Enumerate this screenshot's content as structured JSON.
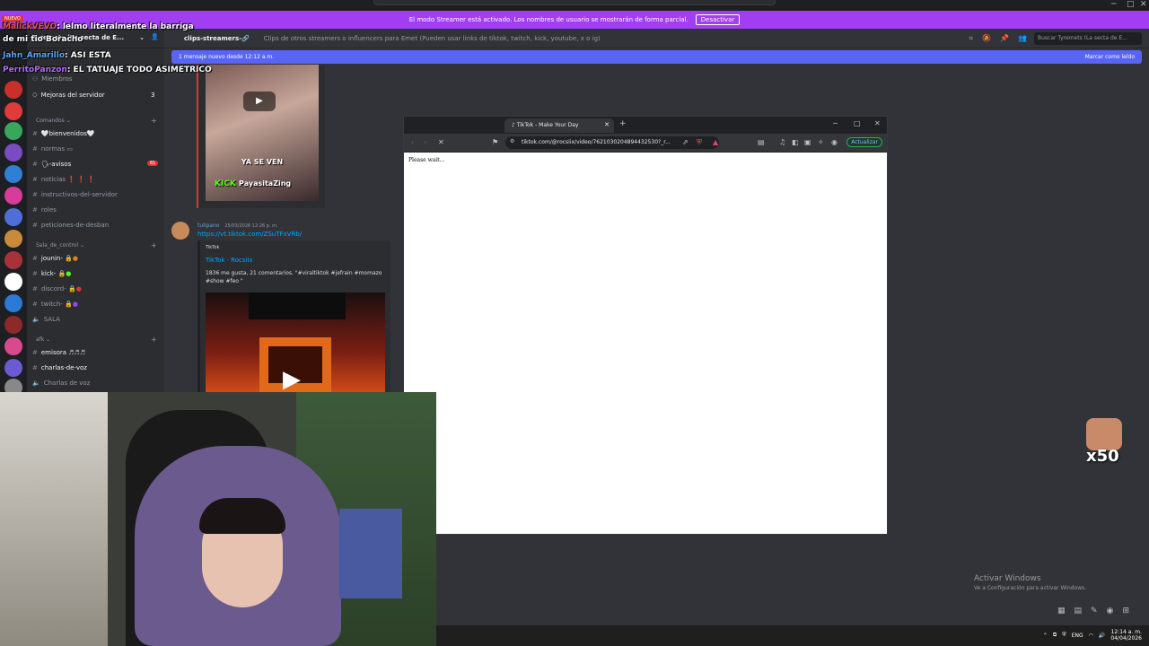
{
  "streamer_banner": {
    "text": "El modo Streamer está activado. Los nombres de usuario se mostrarán de forma parcial.",
    "button": "Desactivar",
    "badge_new": "NUEVO"
  },
  "server_name": "Tyremets (La secta de E...",
  "channels": {
    "members": "Miembros",
    "improvements": "Mejoras del servidor",
    "improvements_count": "3",
    "category_commands": "Comandos",
    "welcome": "🤍bienvenidos🤍",
    "rules": "normas",
    "notices": "🗣-avisos",
    "notices_count": "81",
    "news": "noticias",
    "news_marks": "❗ ❗ ❗",
    "server_instructions": "instructivos-del-servidor",
    "roles": "roles",
    "unban_requests": "peticiones-de-desban",
    "category_control": "Sala_de_control",
    "join": "jounin-",
    "kick": "kick-",
    "discord": "discord-",
    "twitch": "twitch-",
    "room": "SALA",
    "category_afk": "afk",
    "radio": "emisora",
    "voice_chats": "charlas-de-voz",
    "voice_chats_2": "Charlas de voz"
  },
  "chat_header": {
    "channel": "clips-streamers-🔗",
    "topic": "Clips de otros streamers o influencers para Emet (Pueden usar links de tiktok, twitch, kick, youtube, x o ig)",
    "search_placeholder": "Buscar Tyremets (La secta de E..."
  },
  "new_messages": {
    "text": "1 mensaje nuevo desde 12:12 a.m.",
    "mark_read": "Marcar como leído"
  },
  "message": {
    "author": "tulipano",
    "timestamp": "25/03/2026 12:26 p. m.",
    "link": "https://vt.tiktok.com/ZSuTFxVRb/",
    "embed_provider": "TikTok",
    "embed_title": "TikTok · Rocsiix",
    "embed_desc": "1836 me gusta, 21 comentarios. \"#viraltiktok #jefrain #momazo #show #feo \""
  },
  "video_thumb": {
    "caption": "YA SE VEN",
    "kick_label": "KICK",
    "kick_user": "PayasitaZing"
  },
  "overlay_chat": [
    {
      "user": "MalickVEVO",
      "text": ": lelmo literalmente la barriga"
    },
    {
      "user": "",
      "text": "de mi tio Boracho"
    },
    {
      "user": "Jahn_Amarillo",
      "text": ": ASI ESTA"
    },
    {
      "user": "PerritoPanzon",
      "text": ": EL TATUAJE TODO ASIMETRICO"
    }
  ],
  "browser": {
    "tab_title": "TikTok - Make Your Day",
    "url": "tiktok.com/@rocsiix/video/7621030204894432530?_r...",
    "update_button": "Actualizar",
    "content_text": "Please wait..."
  },
  "overlay_emote_count": "x50",
  "windows": {
    "activate_title": "Activar Windows",
    "activate_sub": "Ve a Configuración para activar Windows.",
    "lang": "ENG",
    "time": "12:14 a. m.",
    "date": "04/04/2026"
  },
  "colors": {
    "streamer_banner": "#a23ef2",
    "blurple": "#5865f2",
    "link": "#00a8fc",
    "kick_green": "#53fc18"
  }
}
